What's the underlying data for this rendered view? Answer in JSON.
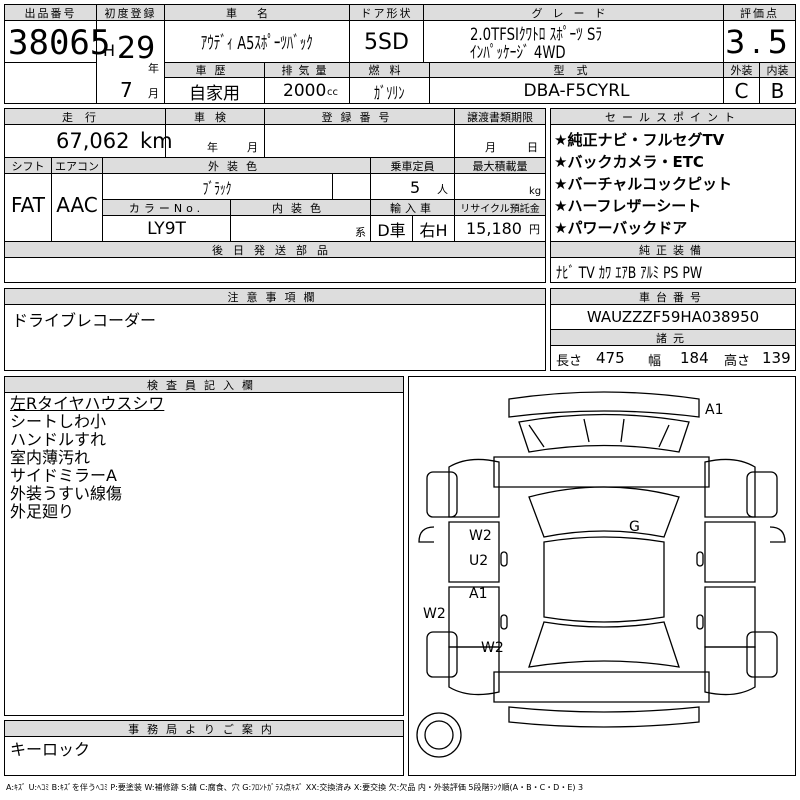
{
  "header": {
    "lot_label": "出品番号",
    "lot_number": "38065",
    "first_reg_label": "初度登録",
    "era_prefix": "H",
    "year_value": "29",
    "year_suffix": "年",
    "month_value": "7",
    "month_suffix": "月",
    "car_name_label": "車名",
    "car_name": "ｱｳﾃﾞｨ A5ｽﾎﾟｰﾂﾊﾞｯｸ",
    "door_label": "ドア形状",
    "door_value": "5SD",
    "grade_label": "グレード",
    "grade_line1": "2.0TFSIｸﾜﾄﾛ ｽﾎﾟｰﾂ Sﾗ",
    "grade_line2": "ｲﾝﾊﾟｯｹｰｼﾞ 4WD",
    "score_label": "評価点",
    "score_value": "3.5",
    "history_label": "車歴",
    "history_value": "自家用",
    "displacement_label": "排気量",
    "displacement_value": "2000",
    "displacement_unit": "cc",
    "fuel_label": "燃料",
    "fuel_value": "ｶﾞｿﾘﾝ",
    "model_code_label": "型式",
    "model_code_value": "DBA-F5CYRL",
    "exterior_grade_label": "外装",
    "exterior_grade_value": "C",
    "interior_grade_label": "内装",
    "interior_grade_value": "B"
  },
  "details": {
    "mileage_label": "走行",
    "mileage_value": "67,062",
    "mileage_unit": "km",
    "inspection_label": "車検",
    "inspection_year_unit": "年",
    "inspection_month_unit": "月",
    "plate_label": "登録番号",
    "transfer_label": "譲渡書類期限",
    "transfer_month_unit": "月",
    "transfer_day_unit": "日",
    "shift_label": "シフト",
    "shift_value": "FAT",
    "ac_label": "エアコン",
    "ac_value": "AAC",
    "ext_color_label": "外装色",
    "ext_color_value": "ﾌﾞﾗｯｸ",
    "capacity_label": "乗車定員",
    "capacity_value": "5",
    "capacity_unit": "人",
    "max_load_label": "最大積載量",
    "max_load_unit": "kg",
    "color_no_label": "カラーNo.",
    "color_no_value": "LY9T",
    "int_color_label": "内装色",
    "int_color_suffix": "系",
    "import_label": "輸入車",
    "import_value": "D車",
    "handle_value": "右H",
    "recycle_label": "リサイクル預託金",
    "recycle_value": "15,180",
    "recycle_unit": "円",
    "later_parts_label": "後日発送部品"
  },
  "sales_points": {
    "label": "セールスポイント",
    "items": [
      "★純正ナビ・フルセグTV",
      "★バックカメラ・ETC",
      "★バーチャルコックピット",
      "★ハーフレザーシート",
      "★パワーバックドア"
    ],
    "equip_label": "純正装備",
    "equip_value": "ﾅﾋﾞ TV ｶﾜ ｴｱB ｱﾙﾐ PS PW"
  },
  "cautions": {
    "label": "注意事項欄",
    "text": "ドライブレコーダー"
  },
  "chassis": {
    "label": "車台番号",
    "value": "WAUZZZF59HA038950",
    "dims_label": "諸元",
    "length_label": "長さ",
    "length_value": "475",
    "width_label": "幅",
    "width_value": "184",
    "height_label": "高さ",
    "height_value": "139"
  },
  "inspector": {
    "label": "検査員記入欄",
    "lines": [
      "左Rタイヤハウスシワ",
      "シートしわ小",
      "ハンドルすれ",
      "室内薄汚れ",
      "サイドミラーA",
      "外装うすい線傷",
      "外足廻り"
    ]
  },
  "office": {
    "label": "事務局よりご案内",
    "text": "キーロック"
  },
  "diagram": {
    "marks": {
      "a1_top": "A1",
      "g": "G",
      "w2_a": "W2",
      "u2": "U2",
      "a1_mid": "A1",
      "w2_side": "W2",
      "w2_b": "W2"
    },
    "brackets": "[ ]"
  },
  "legend": "A:ｷｽﾞ U:ﾍｺﾐ B:ｷｽﾞを伴うﾍｺﾐ P:要塗装 W:補修跡 S:錆 C:腐食、穴 G:ﾌﾛﾝﾄｶﾞﾗｽ点ｷｽﾞ XX:交換済み X:要交換 欠:欠品 内・外装評価 5段階ﾗﾝｸ順(A・B・C・D・E) 3"
}
